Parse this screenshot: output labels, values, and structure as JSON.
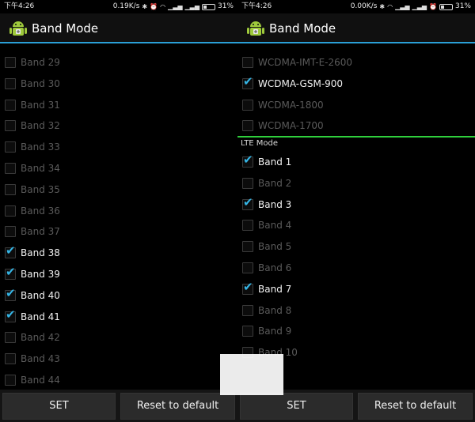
{
  "left": {
    "status": {
      "time": "下午4:26",
      "speed": "0.19K/s",
      "battery": "31%",
      "battery_level": 0.31
    },
    "title": "Band Mode",
    "items": [
      {
        "label": "Band 29",
        "checked": false
      },
      {
        "label": "Band 30",
        "checked": false
      },
      {
        "label": "Band 31",
        "checked": false
      },
      {
        "label": "Band 32",
        "checked": false
      },
      {
        "label": "Band 33",
        "checked": false
      },
      {
        "label": "Band 34",
        "checked": false
      },
      {
        "label": "Band 35",
        "checked": false
      },
      {
        "label": "Band 36",
        "checked": false
      },
      {
        "label": "Band 37",
        "checked": false
      },
      {
        "label": "Band 38",
        "checked": true
      },
      {
        "label": "Band 39",
        "checked": true
      },
      {
        "label": "Band 40",
        "checked": true
      },
      {
        "label": "Band 41",
        "checked": true
      },
      {
        "label": "Band 42",
        "checked": false
      },
      {
        "label": "Band 43",
        "checked": false
      },
      {
        "label": "Band 44",
        "checked": false
      }
    ],
    "buttons": {
      "set": "SET",
      "reset": "Reset to default"
    }
  },
  "right": {
    "status": {
      "time": "下午4:26",
      "speed": "0.00K/s",
      "battery": "31%",
      "battery_level": 0.31
    },
    "title": "Band Mode",
    "wcdma_items": [
      {
        "label": "WCDMA-IMT-E-2600",
        "checked": false
      },
      {
        "label": "WCDMA-GSM-900",
        "checked": true
      },
      {
        "label": "WCDMA-1800",
        "checked": false
      },
      {
        "label": "WCDMA-1700",
        "checked": false
      }
    ],
    "section_header": "LTE Mode",
    "lte_items": [
      {
        "label": "Band 1",
        "checked": true
      },
      {
        "label": "Band 2",
        "checked": false
      },
      {
        "label": "Band 3",
        "checked": true
      },
      {
        "label": "Band 4",
        "checked": false
      },
      {
        "label": "Band 5",
        "checked": false
      },
      {
        "label": "Band 6",
        "checked": false
      },
      {
        "label": "Band 7",
        "checked": true
      },
      {
        "label": "Band 8",
        "checked": false
      },
      {
        "label": "Band 9",
        "checked": false
      },
      {
        "label": "Band 10",
        "checked": false
      }
    ],
    "buttons": {
      "set": "SET",
      "reset": "Reset to default"
    }
  },
  "colors": {
    "accent": "#2a9fd6",
    "check": "#35b5e5",
    "section_divider": "#2fcf3c"
  },
  "icons": {
    "app": "android-icon",
    "bluetooth": "bluetooth-icon",
    "wifi": "wifi-icon",
    "signal": "signal-icon",
    "alarm": "alarm-icon",
    "battery": "battery-icon"
  }
}
